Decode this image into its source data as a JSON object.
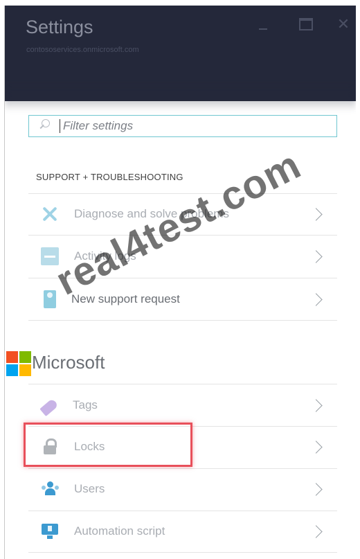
{
  "header": {
    "title": "Settings",
    "subtitle": "contososervices.onmicrosoft.com",
    "window_controls": {
      "minimize_icon": "minimize-icon",
      "maximize_icon": "maximize-icon",
      "close_label": "✕"
    }
  },
  "search": {
    "placeholder": "Filter settings",
    "value": "",
    "icon": "search-icon"
  },
  "sections": [
    {
      "title": "SUPPORT + TROUBLESHOOTING",
      "items": [
        {
          "label": "Diagnose and solve problems",
          "icon": "tools-icon"
        },
        {
          "label": "Activity logs",
          "icon": "activity-log-icon"
        },
        {
          "label": "New support request",
          "icon": "support-request-icon"
        }
      ]
    },
    {
      "title": "Microsoft",
      "items": [
        {
          "label": "Tags",
          "icon": "tag-icon"
        },
        {
          "label": "Locks",
          "icon": "lock-icon"
        },
        {
          "label": "Users",
          "icon": "users-icon"
        },
        {
          "label": "Automation script",
          "icon": "automation-script-icon"
        }
      ]
    }
  ],
  "watermark": "real4test.com",
  "colors": {
    "header_bg": "#24283a",
    "search_border": "#6fc6d0",
    "highlight": "#e8505b"
  }
}
